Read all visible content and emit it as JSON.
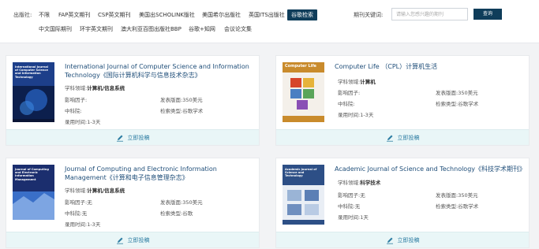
{
  "filters": {
    "publisher_label": "出版社:",
    "publishers": [
      "不限",
      "FAP英文期刊",
      "CSP英文期刊",
      "美国出SCHOLINK版社",
      "美国希尔出版社",
      "英国ITS出版社",
      "谷歌检索",
      "中文国际期刊",
      "环宇英文期刊",
      "澳大利亚百图出版社BBP",
      "谷歌+知网",
      "会议论文集"
    ],
    "keyword_label": "期刊关键词:",
    "keyword_placeholder": "请输入您感兴趣的期刊",
    "search_label": "查询"
  },
  "submit_label": "立即投稿",
  "cards": [
    {
      "title": "International Journal of Computer Science and Information Technology《国际计算机科学与信息技术杂志》",
      "cover_text": "International Journal of Computer Science and Information Technology",
      "field_label": "学科领域:",
      "field": "计算机/信息系统",
      "impact_label": "影响因子:",
      "impact": "",
      "fee_label": "发表版面:",
      "fee": "350美元",
      "cn_label": "中科院:",
      "cn": "",
      "index_label": "检索类型:",
      "index": "谷歌学术",
      "time_label": "录用时间:",
      "time": "1-3天"
    },
    {
      "title": "Computer Life （CPL）计算机生活",
      "cover_text": "Computer Life",
      "field_label": "学科领域:",
      "field": "计算机",
      "impact_label": "影响因子:",
      "impact": "",
      "fee_label": "发表版面:",
      "fee": "350美元",
      "cn_label": "中科院:",
      "cn": "",
      "index_label": "检索类型:",
      "index": "谷歌学术",
      "time_label": "录用时间:",
      "time": "1-3天"
    },
    {
      "title": "Journal of Computing and Electronic Information Management《计算和电子信息管理杂志》",
      "cover_text": "Journal of Computing and Electronic Information Management",
      "field_label": "学科领域:",
      "field": "计算机/信息系统",
      "impact_label": "影响因子:",
      "impact": "无",
      "fee_label": "发表版面:",
      "fee": "350美元",
      "cn_label": "中科院:",
      "cn": "无",
      "index_label": "检索类型:",
      "index": "谷歌",
      "time_label": "录用时间:",
      "time": "1-3天"
    },
    {
      "title": "Academic Journal of Science and Technology《科技学术期刊》",
      "cover_text": "Academic Journal of Science and Technology",
      "field_label": "学科领域:",
      "field": "科学技术",
      "impact_label": "影响因子:",
      "impact": "无",
      "fee_label": "发表版面:",
      "fee": "350美元",
      "cn_label": "中科院:",
      "cn": "无",
      "index_label": "检索类型:",
      "index": "谷歌学术",
      "time_label": "录用时间:",
      "time": "1天"
    }
  ]
}
